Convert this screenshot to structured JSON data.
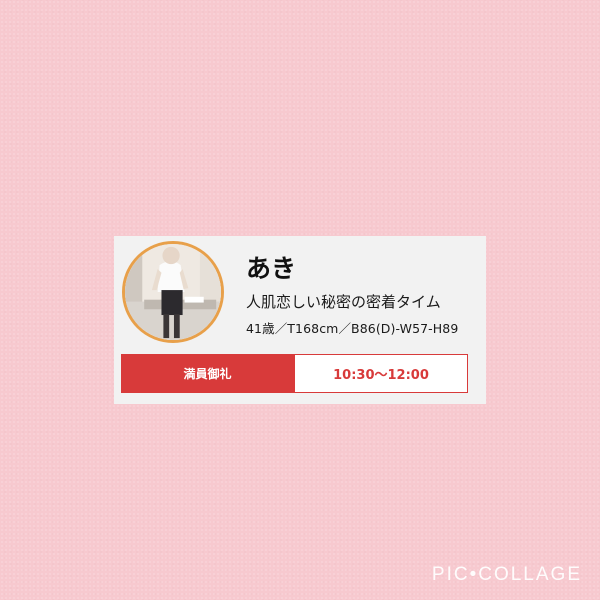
{
  "profile": {
    "name": "あき",
    "tagline": "人肌恋しい秘密の密着タイム",
    "stats": "41歳／T168cm／B86(D)-W57-H89"
  },
  "schedule": {
    "status_label": "満員御礼",
    "time_range": "10:30〜12:00"
  },
  "watermark": "PIC•COLLAGE",
  "colors": {
    "background": "#f7c9cf",
    "card": "#f2f2f2",
    "accent_red": "#d83a3a",
    "avatar_ring": "#e8a04a"
  }
}
